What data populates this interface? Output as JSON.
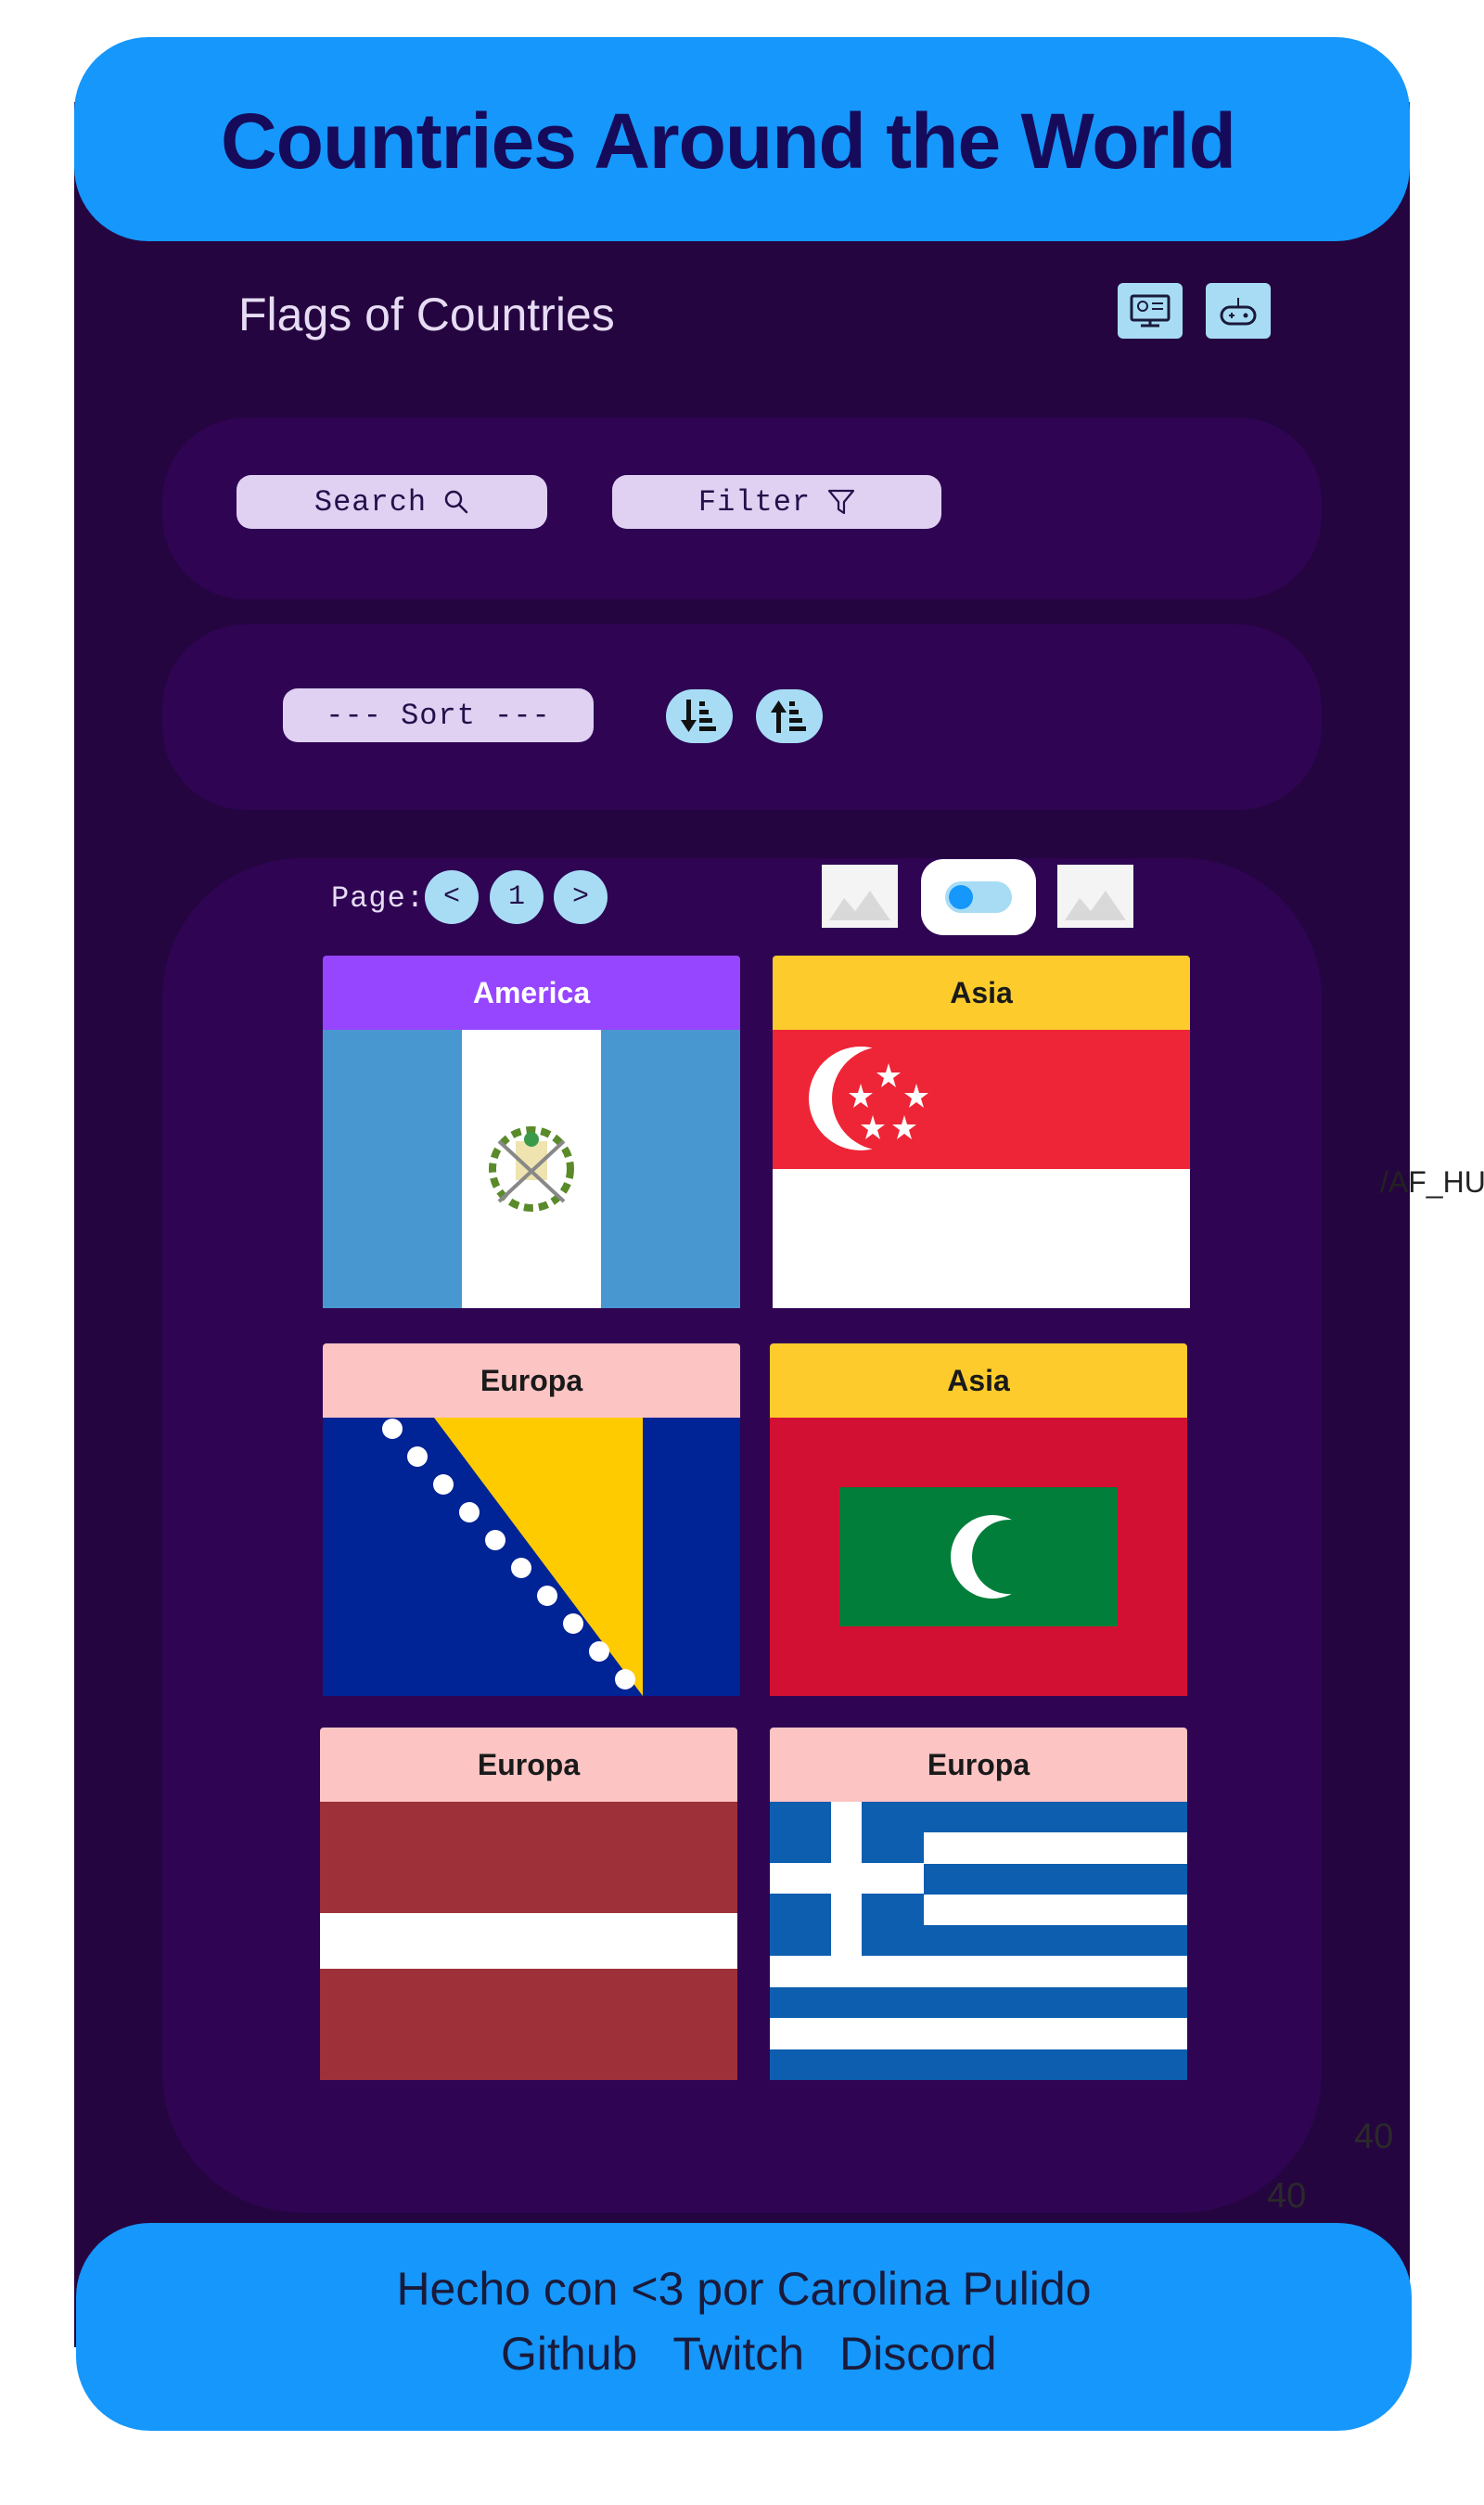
{
  "header": {
    "title": "Countries Around the World"
  },
  "subheader": {
    "title": "Flags of Countries",
    "icons": [
      "monitor-icon",
      "gamepad-icon"
    ]
  },
  "toolbar": {
    "search_label": "Search",
    "filter_label": "Filter",
    "sort_label": "--- Sort ---",
    "sort_desc_icon": "sort-descending-icon",
    "sort_asc_icon": "sort-ascending-icon"
  },
  "pagination": {
    "label": "Page:",
    "prev": "<",
    "current": "1",
    "next": ">"
  },
  "view_toggle": {
    "enabled": true
  },
  "cards": [
    {
      "region": "America",
      "label_color": "#9646ff",
      "text_color": "#ffffff",
      "flag": "guatemala"
    },
    {
      "region": "Asia",
      "label_color": "#fdcb2c",
      "text_color": "#1a1a1a",
      "flag": "singapore"
    },
    {
      "region": "Europa",
      "label_color": "#fdc4c4",
      "text_color": "#1a1a1a",
      "flag": "bosnia"
    },
    {
      "region": "Asia",
      "label_color": "#fdcb2c",
      "text_color": "#1a1a1a",
      "flag": "maldives"
    },
    {
      "region": "Europa",
      "label_color": "#fdc4c4",
      "text_color": "#1a1a1a",
      "flag": "latvia"
    },
    {
      "region": "Europa",
      "label_color": "#fdc4c4",
      "text_color": "#1a1a1a",
      "flag": "greece"
    }
  ],
  "stray_text": "/AF_HU",
  "ghost_numbers": [
    "40",
    "40"
  ],
  "footer": {
    "credit": "Hecho con <3 por Carolina Pulido",
    "links": [
      "Github",
      "Twitch",
      "Discord"
    ]
  },
  "colors": {
    "accent": "#1597fc",
    "background": "#25053f",
    "panel": "#2e0453",
    "pill": "#e0d1f3",
    "icon_button": "#a8dcf5"
  }
}
